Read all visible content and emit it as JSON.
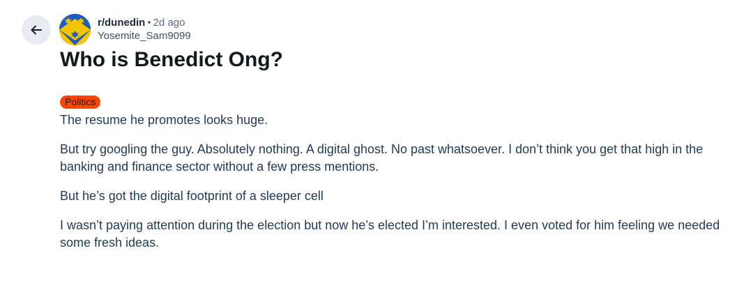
{
  "post": {
    "subreddit": "r/dunedin",
    "separator": "•",
    "age": "2d ago",
    "author": "Yosemite_Sam9099",
    "title": "Who is Benedict Ong?",
    "flair": "Politics",
    "paragraphs": [
      "The resume he promotes looks huge.",
      "But try googling the guy. Absolutely nothing. A digital ghost. No past whatsoever. I don’t think you get that high in the banking and finance sector without a few press mentions.",
      "But he’s got the digital footprint of a sleeper cell",
      "I wasn’t paying attention during the election but now he’s elected I’m interested. I even voted for him feeling we needed some fresh ideas."
    ]
  },
  "icons": {
    "back": "arrow-left-icon",
    "avatar": "subreddit-avatar-icon"
  },
  "colors": {
    "flair_bg": "#ff4500",
    "avatar_blue": "#1f5bbf",
    "avatar_yellow": "#f2c500",
    "back_button_bg": "#e8ecf2"
  }
}
